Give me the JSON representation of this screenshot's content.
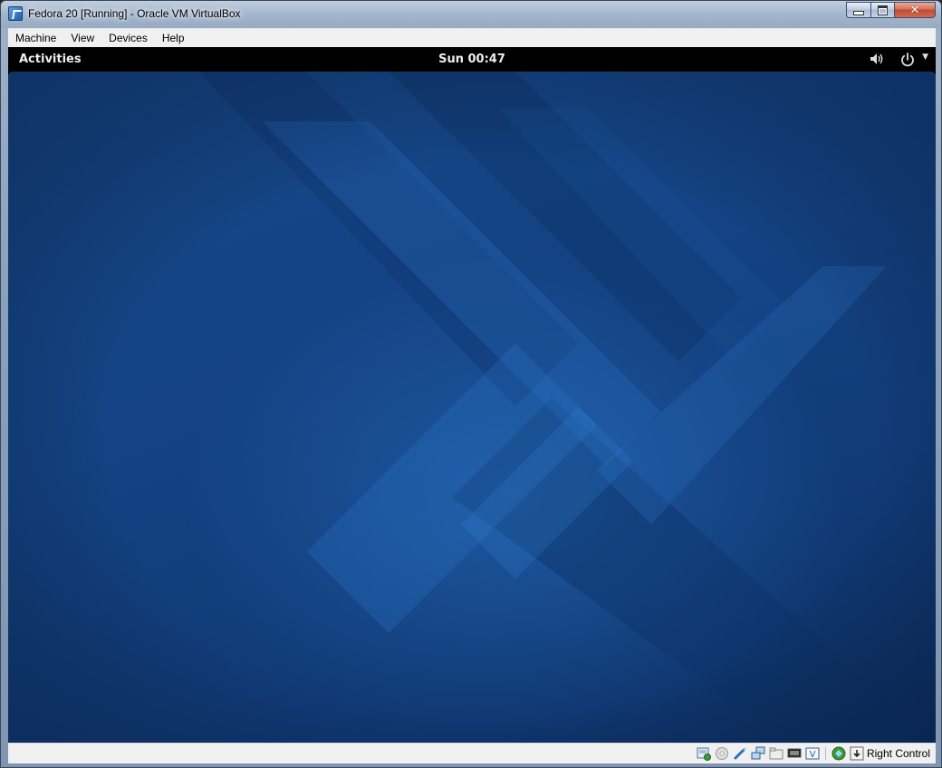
{
  "window": {
    "title": "Fedora 20 [Running] - Oracle VM VirtualBox",
    "icon": "virtualbox-icon",
    "buttons": [
      "minimize-icon",
      "maximize-icon",
      "close-icon"
    ]
  },
  "menubar": {
    "items": [
      {
        "label": "Machine"
      },
      {
        "label": "View"
      },
      {
        "label": "Devices"
      },
      {
        "label": "Help"
      }
    ]
  },
  "gnome": {
    "activities_label": "Activities",
    "clock": "Sun 00:47",
    "tray_icons": [
      "volume-icon",
      "power-icon",
      "dropdown-arrow-icon"
    ]
  },
  "statusbar": {
    "icons": [
      "hard-disk-icon",
      "optical-drive-icon",
      "usb-icon",
      "network-icon",
      "shared-folders-icon",
      "display-icon",
      "video-capture-icon",
      "mouse-integration-icon",
      "host-key-icon"
    ],
    "host_key_label": "Right Control"
  },
  "colors": {
    "desktop_blue": "#144283",
    "topbar_black": "#000000",
    "menubar_gray": "#f0f0f0"
  }
}
